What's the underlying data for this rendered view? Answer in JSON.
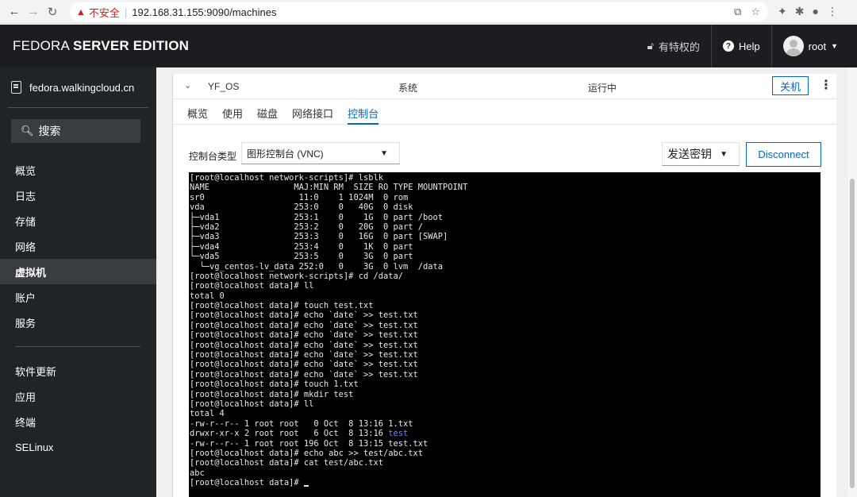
{
  "browser": {
    "insecure_label": "不安全",
    "separator": "|",
    "url": "192.168.31.155:9090/machines"
  },
  "header": {
    "brand_part1": "FEDORA ",
    "brand_part2": "SERVER EDITION",
    "privileged": "有特权的",
    "help": "Help",
    "user": "root"
  },
  "sidebar": {
    "host": "fedora.walkingcloud.cn",
    "search": "搜索",
    "items": [
      "概览",
      "日志",
      "存储",
      "网络",
      "虚拟机",
      "账户",
      "服务"
    ],
    "items2": [
      "软件更新",
      "应用",
      "终端",
      "SELinux"
    ]
  },
  "vm": {
    "name": "YF_OS",
    "connection": "系统",
    "state": "运行中",
    "shutdown": "关机",
    "tabs": [
      "概览",
      "使用",
      "磁盘",
      "网络接口",
      "控制台"
    ]
  },
  "console": {
    "type_label": "控制台类型",
    "type_value": "图形控制台 (VNC)",
    "send_key": "发送密钥",
    "disconnect": "Disconnect",
    "lines": [
      "[root@localhost network-scripts]# lsblk",
      "NAME                 MAJ:MIN RM  SIZE RO TYPE MOUNTPOINT",
      "sr0                   11:0    1 1024M  0 rom",
      "vda                  253:0    0   40G  0 disk",
      "├─vda1               253:1    0    1G  0 part /boot",
      "├─vda2               253:2    0   20G  0 part /",
      "├─vda3               253:3    0   16G  0 part [SWAP]",
      "├─vda4               253:4    0    1K  0 part",
      "└─vda5               253:5    0    3G  0 part",
      "  └─vg_centos-lv_data 252:0   0    3G  0 lvm  /data",
      "[root@localhost network-scripts]# cd /data/",
      "[root@localhost data]# ll",
      "total 0",
      "[root@localhost data]# touch test.txt",
      "[root@localhost data]# echo `date` >> test.txt",
      "[root@localhost data]# echo `date` >> test.txt",
      "[root@localhost data]# echo `date` >> test.txt",
      "[root@localhost data]# echo `date` >> test.txt",
      "[root@localhost data]# echo `date` >> test.txt",
      "[root@localhost data]# echo `date` >> test.txt",
      "[root@localhost data]# echo `date` >> test.txt",
      "[root@localhost data]# touch 1.txt",
      "[root@localhost data]# mkdir test",
      "[root@localhost data]# ll",
      "total 4",
      "-rw-r--r-- 1 root root   0 Oct  8 13:16 1.txt",
      "drwxr-xr-x 2 root root   6 Oct  8 13:16 ",
      "-rw-r--r-- 1 root root 196 Oct  8 13:15 test.txt",
      "[root@localhost data]# echo abc >> test/abc.txt",
      "[root@localhost data]# cat test/abc.txt",
      "abc",
      "[root@localhost data]# "
    ],
    "dir_highlight": "test"
  },
  "colors": {
    "header_bg": "#1b1d21",
    "sidebar_bg": "#212427",
    "accent": "#0066cc",
    "terminal_bg": "#000000"
  }
}
